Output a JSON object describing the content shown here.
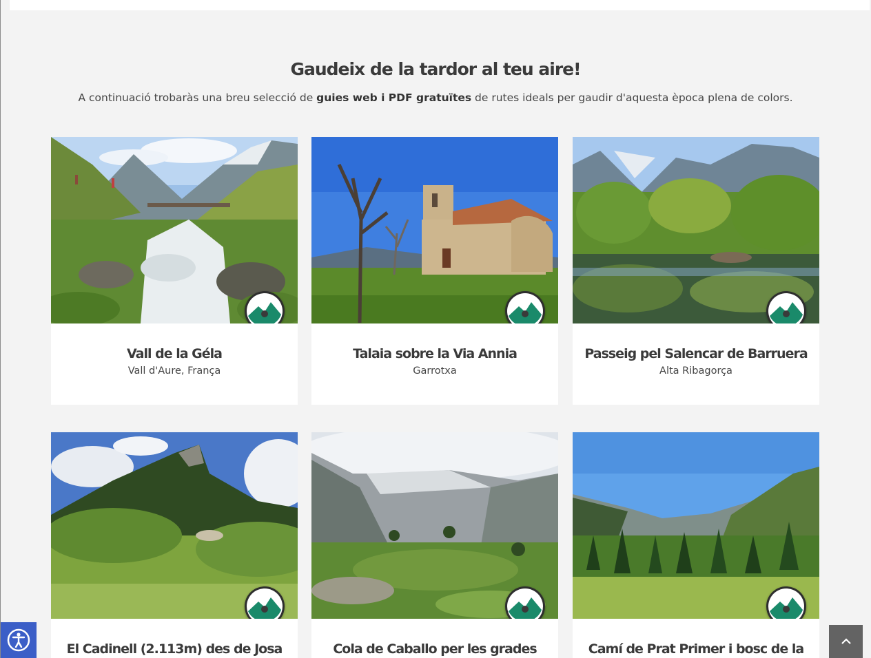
{
  "section": {
    "heading": "Gaudeix de la tardor al teu aire!",
    "intro_before": "A continuació trobaràs una breu selecció de ",
    "intro_bold": "guies web i PDF gratuïtes",
    "intro_after": " de rutes ideals per gaudir d'aquesta època plena de colors."
  },
  "cards": [
    {
      "title": "Vall de la Géla",
      "region": "Vall d'Aure, França",
      "badge_icon": "route-guide-logo-icon"
    },
    {
      "title": "Talaia sobre la Via Annia",
      "region": "Garrotxa",
      "badge_icon": "route-guide-logo-icon"
    },
    {
      "title": "Passeig pel Salencar de Barruera",
      "region": "Alta Ribagorça",
      "badge_icon": "route-guide-logo-icon"
    },
    {
      "title": "El Cadinell (2.113m) des de Josa",
      "region": "",
      "badge_icon": "route-guide-logo-icon"
    },
    {
      "title": "Cola de Caballo per les grades",
      "region": "",
      "badge_icon": "route-guide-logo-icon"
    },
    {
      "title": "Camí de Prat Primer i bosc de la",
      "region": "",
      "badge_icon": "route-guide-logo-icon"
    }
  ],
  "controls": {
    "accessibility_icon": "accessibility-icon",
    "back_to_top_icon": "chevron-up-icon"
  },
  "colors": {
    "page_background": "#f3f3f3",
    "card_background": "#ffffff",
    "badge_green": "#1a8a6a",
    "accessibility_blue": "#3b5ec7",
    "back_to_top_gray": "#636363"
  }
}
